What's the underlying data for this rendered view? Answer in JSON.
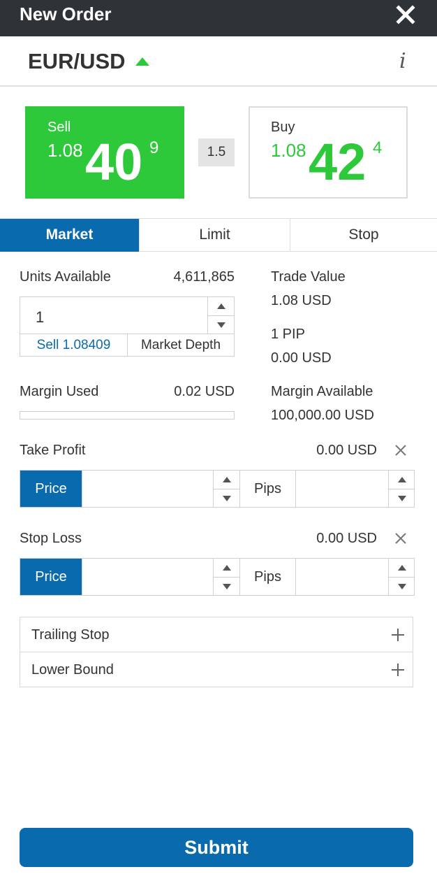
{
  "header": {
    "title": "New Order"
  },
  "instrument": {
    "pair": "EUR/USD",
    "direction": "up"
  },
  "quotes": {
    "sell": {
      "label": "Sell",
      "prefix": "1.08",
      "big": "40",
      "sup": "9"
    },
    "buy": {
      "label": "Buy",
      "prefix": "1.08",
      "big": "42",
      "sup": "4"
    },
    "spread": "1.5"
  },
  "tabs": [
    "Market",
    "Limit",
    "Stop"
  ],
  "units": {
    "label": "Units Available",
    "available": "4,611,865",
    "value": "1",
    "sell_button": "Sell 1.08409",
    "depth_button": "Market Depth"
  },
  "trade": {
    "value_label": "Trade Value",
    "value": "1.08 USD",
    "pip_label": "1 PIP",
    "pip_value": "0.00 USD"
  },
  "margin": {
    "used_label": "Margin Used",
    "used": "0.02 USD",
    "used_fraction": 0.0,
    "available_label": "Margin Available",
    "available": "100,000.00 USD"
  },
  "take_profit": {
    "label": "Take Profit",
    "value": "0.00 USD",
    "price_label": "Price",
    "pips_label": "Pips",
    "price_input": "",
    "pips_input": ""
  },
  "stop_loss": {
    "label": "Stop Loss",
    "value": "0.00 USD",
    "price_label": "Price",
    "pips_label": "Pips",
    "price_input": "",
    "pips_input": ""
  },
  "options": [
    "Trailing Stop",
    "Lower Bound"
  ],
  "submit_label": "Submit",
  "colors": {
    "header_bg": "#2e3338",
    "accent_blue": "#0a6aae",
    "sell_green": "#2ec93b",
    "buy_green": "#2ec93b"
  }
}
